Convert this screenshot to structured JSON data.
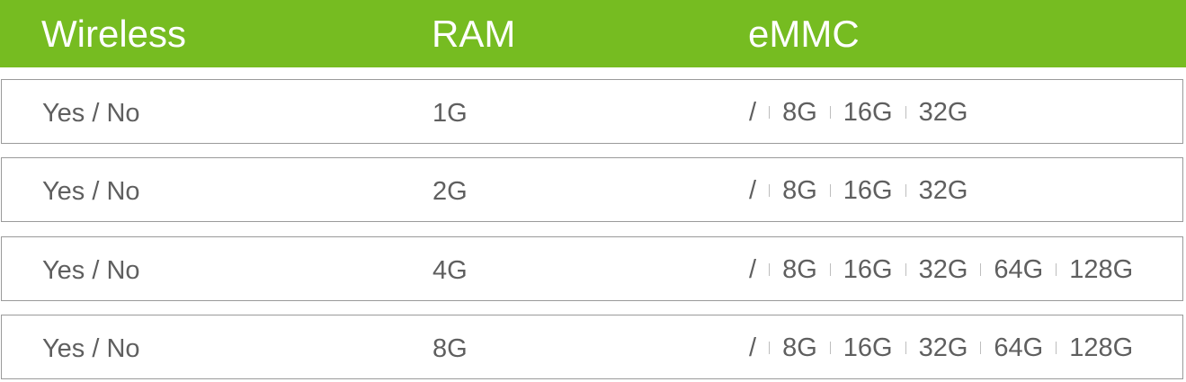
{
  "header": {
    "wireless": "Wireless",
    "ram": "RAM",
    "emmc": "eMMC"
  },
  "rows": [
    {
      "wireless": "Yes / No",
      "ram": "1G",
      "emmc": [
        "/",
        "8G",
        "16G",
        "32G"
      ]
    },
    {
      "wireless": "Yes / No",
      "ram": "2G",
      "emmc": [
        "/",
        "8G",
        "16G",
        "32G"
      ]
    },
    {
      "wireless": "Yes / No",
      "ram": "4G",
      "emmc": [
        "/",
        "8G",
        "16G",
        "32G",
        "64G",
        "128G"
      ]
    },
    {
      "wireless": "Yes / No",
      "ram": "8G",
      "emmc": [
        "/",
        "8G",
        "16G",
        "32G",
        "64G",
        "128G"
      ]
    }
  ],
  "colors": {
    "header_bg": "#76bc21",
    "header_text": "#ffffff",
    "cell_text": "#5f5f5f",
    "row_border": "#9a9a9a"
  }
}
